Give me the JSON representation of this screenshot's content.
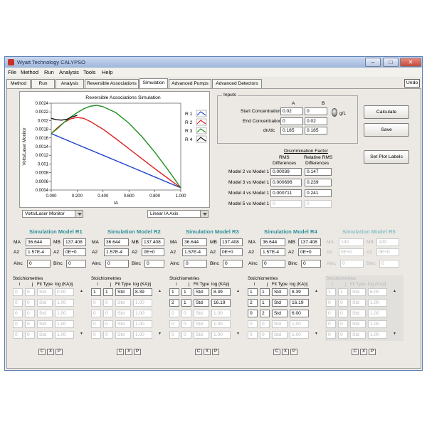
{
  "window": {
    "title": "Wyatt Technology CALYPSO",
    "controls": {
      "minimize": "–",
      "maximize": "□",
      "close": "✕"
    }
  },
  "menu": [
    "File",
    "Method",
    "Run",
    "Analysis",
    "Tools",
    "Help"
  ],
  "tabs": [
    "Method",
    "Run",
    "Analysis",
    "Reversible Associations",
    "Simulation",
    "Advanced Pumps",
    "Advanced Detectors"
  ],
  "active_tab": "Simulation",
  "undo_label": "Undo",
  "chart": {
    "title": "Reversible Associations Simulation",
    "ylabel": "Volts/Laser Monitor",
    "xlabel": "IA",
    "yticks": [
      "0.0024",
      "0.0022",
      "0.002",
      "0.0018",
      "0.0016",
      "0.0014",
      "0.0012",
      "0.001",
      "0.0008",
      "0.0006",
      "0.0004"
    ],
    "xticks": [
      "0.000",
      "0.200",
      "0.400",
      "0.600",
      "0.800",
      "1.000"
    ],
    "legend": [
      {
        "label": "R 1",
        "color": "#2244cc"
      },
      {
        "label": "R 2",
        "color": "#dd2222"
      },
      {
        "label": "R 3",
        "color": "#1f8f1f"
      },
      {
        "label": "R 4",
        "color": "#111111"
      }
    ]
  },
  "chart_data": {
    "type": "line",
    "title": "Reversible Associations Simulation",
    "xlabel": "IA",
    "ylabel": "Volts/Laser Monitor",
    "xlim": [
      0,
      1
    ],
    "ylim": [
      0.0004,
      0.0024
    ],
    "series": [
      {
        "name": "R 1",
        "color": "#2244cc",
        "x": [
          0,
          0.2,
          0.4,
          0.6,
          0.8,
          1.0
        ],
        "y": [
          0.0017,
          0.00145,
          0.0012,
          0.00095,
          0.0007,
          0.00045
        ]
      },
      {
        "name": "R 2",
        "color": "#dd2222",
        "x": [
          0,
          0.05,
          0.1,
          0.15,
          0.2,
          0.25,
          0.3,
          0.4,
          0.5,
          0.6,
          0.7,
          0.8,
          0.9,
          1.0
        ],
        "y": [
          0.0017,
          0.00184,
          0.00196,
          0.00204,
          0.00207,
          0.00205,
          0.00198,
          0.0018,
          0.00158,
          0.00135,
          0.00112,
          0.00089,
          0.00067,
          0.00045
        ]
      },
      {
        "name": "R 3",
        "color": "#1f8f1f",
        "x": [
          0,
          0.05,
          0.1,
          0.15,
          0.2,
          0.25,
          0.3,
          0.35,
          0.4,
          0.5,
          0.6,
          0.7,
          0.8,
          0.9,
          1.0
        ],
        "y": [
          0.0017,
          0.00182,
          0.00196,
          0.00208,
          0.00218,
          0.00227,
          0.00233,
          0.00235,
          0.00232,
          0.00218,
          0.00194,
          0.00163,
          0.00127,
          0.00087,
          0.00045
        ]
      },
      {
        "name": "R 4",
        "color": "#111111",
        "x": [
          0,
          0.04,
          0.08,
          0.12,
          0.16,
          0.2
        ],
        "y": [
          0.00205,
          0.00202,
          0.00201,
          0.00203,
          0.00208,
          0.00212
        ]
      }
    ]
  },
  "left_dropdowns": {
    "y_axis": "Volts/Laser Monitor",
    "x_axis": "Linear IA Axis"
  },
  "inputs": {
    "group_label": "Inputs",
    "col_a": "A",
    "col_b": "B",
    "start_label": "Start Concentration",
    "start_a": "0.02",
    "start_b": "0",
    "end_label": "End Concentration",
    "end_a": "0",
    "end_b": "0.02",
    "dndc_label": "dn/dc",
    "dndc_a": "0.185",
    "dndc_b": "0.185",
    "unit": "g/L"
  },
  "buttons": {
    "calculate": "Calculate",
    "save": "Save",
    "set_plot_labels": "Set Plot Labels"
  },
  "discrimination": {
    "title": "Discrimination Factor",
    "col1_line1": "RMS",
    "col1_line2": "Differences",
    "col2_line1": "Relative RMS",
    "col2_line2": "Differences",
    "rows": [
      {
        "label": "Model 2 vs Model 1",
        "rms": "0.00039",
        "rel": "0.147",
        "dim": false
      },
      {
        "label": "Model 3 vs Model 1",
        "rms": "0.000696",
        "rel": "0.239",
        "dim": false
      },
      {
        "label": "Model 4 vs Model 1",
        "rms": "0.000711",
        "rel": "0.241",
        "dim": false
      },
      {
        "label": "Model 5 vs Model 1",
        "rms": "0",
        "rel": "0",
        "dim": true
      }
    ]
  },
  "models": [
    {
      "title": "Simulation Model R1",
      "ma": "36.644",
      "mb": "137.408",
      "a2": "1.57E-4",
      "a2b": "0E+0",
      "ainc": "0",
      "binc": "0",
      "dim": false,
      "rows": [
        [
          "0",
          "0",
          "Std",
          "0.00"
        ],
        [
          "0",
          "0",
          "Std",
          "1.00"
        ],
        [
          "0",
          "0",
          "Std",
          "1.00"
        ],
        [
          "0",
          "0",
          "Std",
          "1.00"
        ],
        [
          "0",
          "0",
          "Std",
          "1.00"
        ]
      ],
      "rowdim": [
        true,
        true,
        true,
        true,
        true
      ]
    },
    {
      "title": "Simulation Model R2",
      "ma": "36.644",
      "mb": "137.408",
      "a2": "1.57E-4",
      "a2b": "0E+0",
      "ainc": "0",
      "binc": "0",
      "dim": false,
      "rows": [
        [
          "1",
          "1",
          "Std",
          "8.39"
        ],
        [
          "0",
          "0",
          "Std",
          "1.00"
        ],
        [
          "0",
          "0",
          "Std",
          "1.00"
        ],
        [
          "0",
          "0",
          "Std",
          "1.00"
        ],
        [
          "0",
          "0",
          "Std",
          "1.00"
        ]
      ],
      "rowdim": [
        false,
        true,
        true,
        true,
        true
      ]
    },
    {
      "title": "Simulation Model R3",
      "ma": "36.644",
      "mb": "137.408",
      "a2": "1.57E-4",
      "a2b": "0E+0",
      "ainc": "0",
      "binc": "0",
      "dim": false,
      "rows": [
        [
          "1",
          "1",
          "Std",
          "8.39"
        ],
        [
          "2",
          "1",
          "Std",
          "16.19"
        ],
        [
          "0",
          "0",
          "Std",
          "1.00"
        ],
        [
          "0",
          "0",
          "Std",
          "1.00"
        ],
        [
          "0",
          "0",
          "Std",
          "1.00"
        ]
      ],
      "rowdim": [
        false,
        false,
        true,
        true,
        true
      ]
    },
    {
      "title": "Simulation Model R4",
      "ma": "36.644",
      "mb": "137.408",
      "a2": "1.57E-4",
      "a2b": "0E+0",
      "ainc": "0",
      "binc": "0",
      "dim": false,
      "rows": [
        [
          "1",
          "1",
          "Std",
          "8.39"
        ],
        [
          "2",
          "1",
          "Std",
          "16.19"
        ],
        [
          "0",
          "2",
          "Std",
          "6.00"
        ],
        [
          "0",
          "0",
          "Std",
          "1.00"
        ],
        [
          "0",
          "0",
          "Std",
          "1.00"
        ]
      ],
      "rowdim": [
        false,
        false,
        false,
        true,
        true
      ]
    },
    {
      "title": "Simulation Model R5",
      "ma": "100",
      "mb": "100",
      "a2": "0E+0",
      "a2b": "0E+0",
      "ainc": "0",
      "binc": "0",
      "dim": true,
      "rows": [
        [
          "1",
          "1",
          "Std",
          "6.00"
        ],
        [
          "0",
          "0",
          "Std",
          "1.00"
        ],
        [
          "0",
          "0",
          "Std",
          "1.00"
        ],
        [
          "0",
          "0",
          "Std",
          "1.00"
        ],
        [
          "0",
          "0",
          "Std",
          "1.00"
        ]
      ],
      "rowdim": [
        true,
        true,
        true,
        true,
        true
      ]
    }
  ],
  "labels": {
    "ma": "MA",
    "mb": "MB",
    "a2": "A2",
    "ainc": "Ainc",
    "binc": "Binc",
    "stoich": "Stoichiometries",
    "i": "i",
    "j": "j",
    "fit": "Fit Type",
    "logk": "log (KA)ij",
    "btn_c": "C",
    "btn_x": "X",
    "btn_p": "P"
  }
}
